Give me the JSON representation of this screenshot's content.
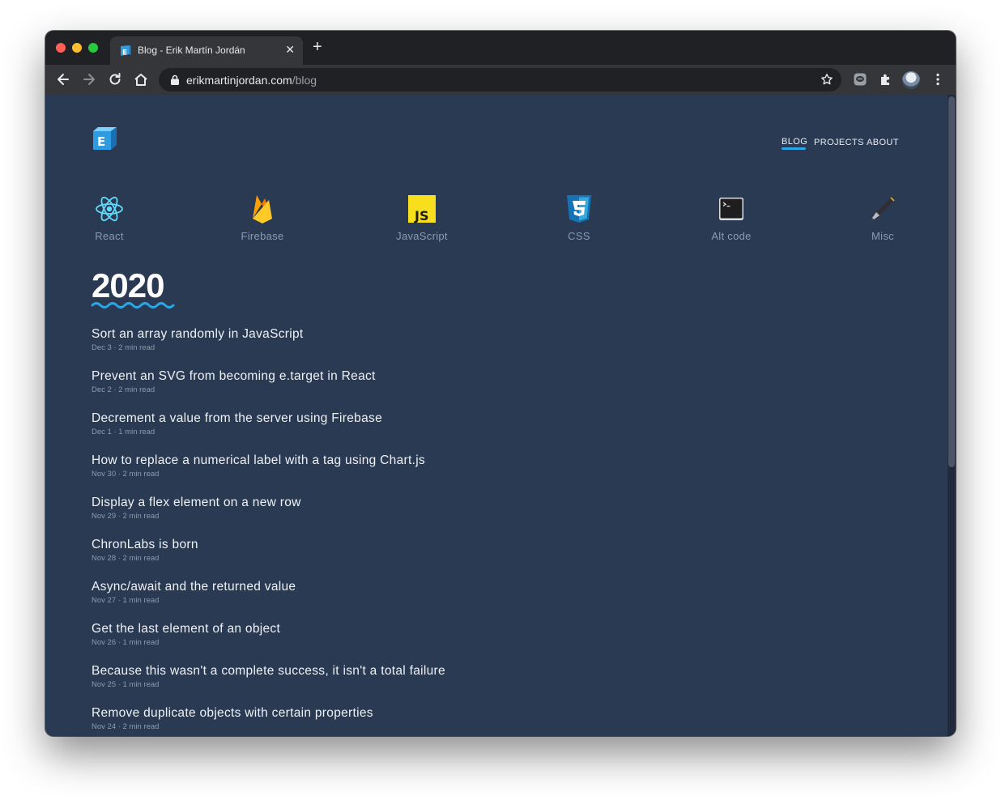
{
  "browser": {
    "tab_title": "Blog - Erik Martín Jordán",
    "tab_close": "✕",
    "new_tab": "+",
    "url_host": "erikmartinjordan.com",
    "url_path": "/blog"
  },
  "site": {
    "logo_letter": "E",
    "nav": [
      "BLOG",
      "PROJECTS",
      "ABOUT"
    ],
    "active_nav": "BLOG",
    "accent_color": "#2aa6e6",
    "background_color": "#2a3a52",
    "categories": [
      {
        "label": "React",
        "icon": "react-icon"
      },
      {
        "label": "Firebase",
        "icon": "firebase-icon"
      },
      {
        "label": "JavaScript",
        "icon": "javascript-icon"
      },
      {
        "label": "CSS",
        "icon": "css-icon"
      },
      {
        "label": "Alt code",
        "icon": "terminal-icon"
      },
      {
        "label": "Misc",
        "icon": "pen-icon"
      }
    ],
    "year": "2020",
    "posts": [
      {
        "title": "Sort an array randomly in JavaScript",
        "meta": "Dec 3 · 2 min read"
      },
      {
        "title": "Prevent an SVG from becoming e.target in React",
        "meta": "Dec 2 · 2 min read"
      },
      {
        "title": "Decrement a value from the server using Firebase",
        "meta": "Dec 1 · 1 min read"
      },
      {
        "title": "How to replace a numerical label with a tag using Chart.js",
        "meta": "Nov 30 · 2 min read"
      },
      {
        "title": "Display a flex element on a new row",
        "meta": "Nov 29 · 2 min read"
      },
      {
        "title": "ChronLabs is born",
        "meta": "Nov 28 · 2 min read"
      },
      {
        "title": "Async/await and the returned value",
        "meta": "Nov 27 · 1 min read"
      },
      {
        "title": "Get the last element of an object",
        "meta": "Nov 26 · 1 min read"
      },
      {
        "title": "Because this wasn't a complete success, it isn't a total failure",
        "meta": "Nov 25 · 1 min read"
      },
      {
        "title": "Remove duplicate objects with certain properties",
        "meta": "Nov 24 · 2 min read"
      }
    ]
  }
}
